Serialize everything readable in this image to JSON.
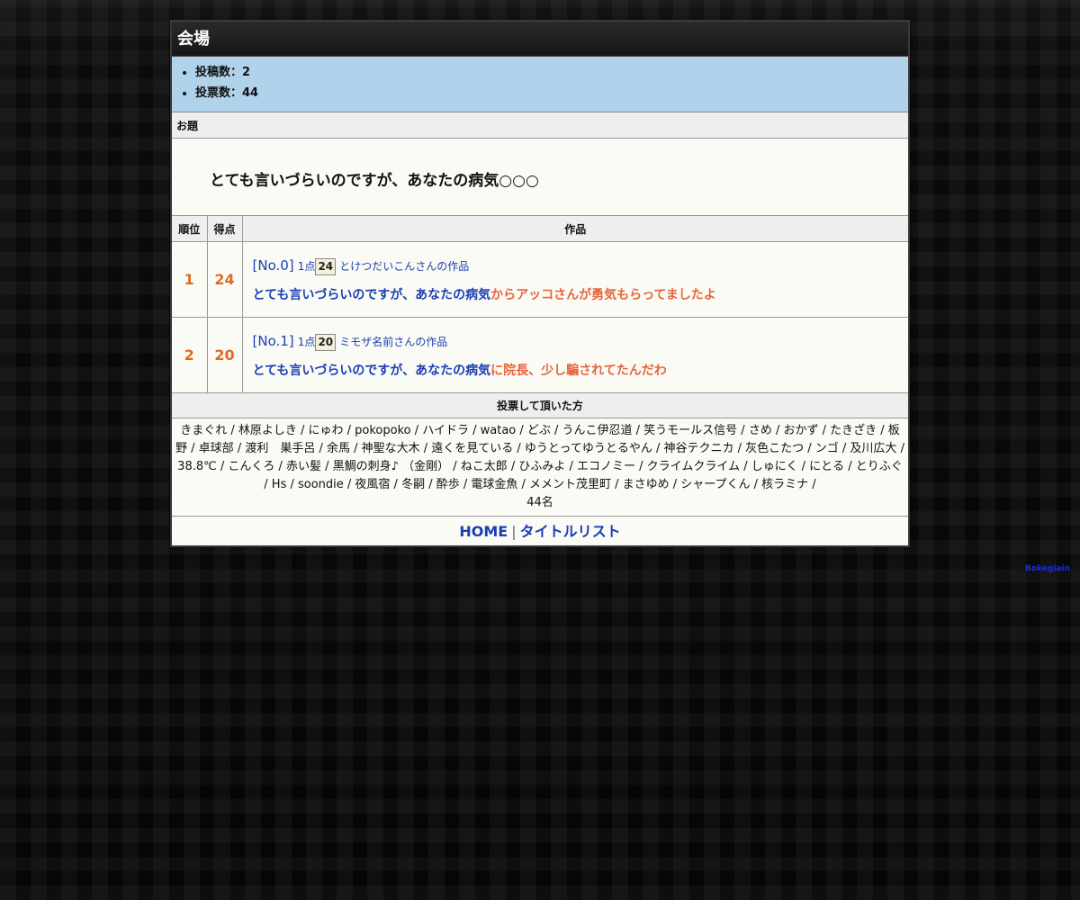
{
  "venue": {
    "title": "会場",
    "stats": [
      "投稿数：2",
      "投票数：44"
    ]
  },
  "topic": {
    "label": "お題",
    "text": "とても言いづらいのですが、あなたの病気○○○"
  },
  "results": {
    "headers": {
      "rank": "順位",
      "score": "得点",
      "work": "作品"
    },
    "entries": [
      {
        "rank": "1",
        "score": "24",
        "no": "[No.0]",
        "pts_label": "1点",
        "votes": "24",
        "author": "とけつだいこんさんの作品",
        "answer_prefix": "とても言いづらいのですが、あなたの病気",
        "answer_suffix": "からアッコさんが勇気もらってましたよ"
      },
      {
        "rank": "2",
        "score": "20",
        "no": "[No.1]",
        "pts_label": "1点",
        "votes": "20",
        "author": "ミモザ名前さんの作品",
        "answer_prefix": "とても言いづらいのですが、あなたの病気",
        "answer_suffix": "に院長、少し騙されてたんだわ"
      }
    ]
  },
  "voters": {
    "title": "投票して頂いた方",
    "list": "きまぐれ / 林原よしき / にゅわ / pokopoko / ハイドラ / watao / どぶ / うんこ伊忍道 / 笑うモールス信号 / さめ / おかず / たきざき / 板野 / 卓球部 / 渡利　巣手呂 / 余馬 / 神聖な大木 / 遠くを見ている / ゆうとってゆうとるやん / 神谷テクニカ / 灰色こたつ / ンゴ / 及川広大 / 38.8℃ / こんくろ / 赤い髪 / 黒鯛の刺身♪ （金剛） / ねこ太郎 / ひふみよ / エコノミー / クライムクライム / しゅにく / にとる / とりふぐ / Hs / soondie / 夜風宿 / 冬嗣 / 酔歩 / 電球金魚 / メメント茂里町 / まさゆめ / シャープくん / 核ラミナ /",
    "count": "44名"
  },
  "footer": {
    "home": "HOME",
    "separator": "|",
    "title_list": "タイトルリスト"
  },
  "corner_link": "Bokegiain",
  "colors": {
    "accent_orange": "#e06a22",
    "link_blue": "#1a3fb5",
    "stats_bg": "#b0d2ea",
    "header_bg": "#1e1e1e"
  }
}
